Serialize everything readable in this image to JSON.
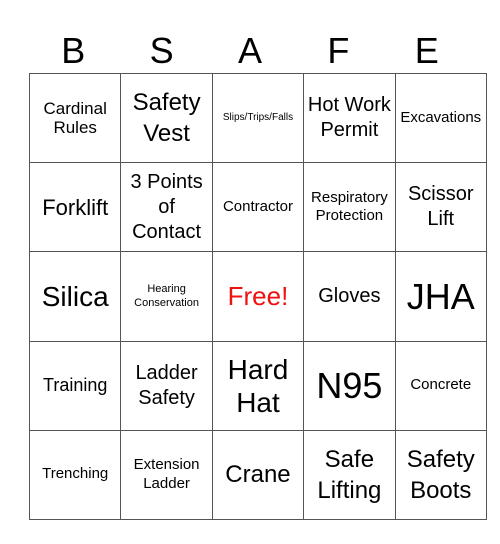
{
  "header": [
    "B",
    "S",
    "A",
    "F",
    "E"
  ],
  "free_color": "#ee1111",
  "rows": [
    [
      "Cardinal Rules",
      "Safety Vest",
      "Slips/Trips/Falls",
      "Hot Work Permit",
      "Excavations"
    ],
    [
      "Forklift",
      "3 Points of Contact",
      "Contractor",
      "Respiratory Protection",
      "Scissor Lift"
    ],
    [
      "Silica",
      "Hearing Conservation",
      "Free!",
      "Gloves",
      "JHA"
    ],
    [
      "Training",
      "Ladder Safety",
      "Hard Hat",
      "N95",
      "Concrete"
    ],
    [
      "Trenching",
      "Extension Ladder",
      "Crane",
      "Safe Lifting",
      "Safety Boots"
    ]
  ]
}
